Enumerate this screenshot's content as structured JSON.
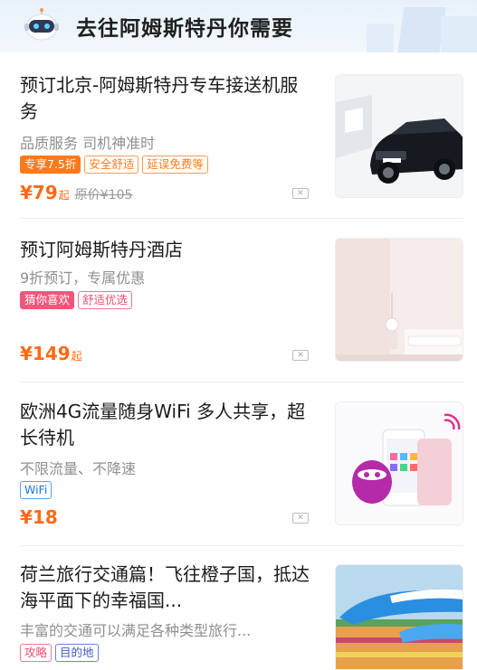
{
  "header": {
    "title": "去往阿姆斯特丹你需要",
    "icon": "robot-icon"
  },
  "cards": [
    {
      "title": "预订北京-阿姆斯特丹专车接送机服务",
      "subtitle": "品质服务 司机神准时",
      "tags": [
        "专享7.5折",
        "安全舒适",
        "延误免费等"
      ],
      "price": "¥79",
      "price_suffix": "起",
      "original_price": "原价¥105",
      "image": "black-suv-image"
    },
    {
      "title": "预订阿姆斯特丹酒店",
      "subtitle": "9折预订，专属优惠",
      "tags": [
        "猜你喜欢",
        "舒适优选"
      ],
      "price": "¥149",
      "price_suffix": "起",
      "image": "hotel-room-image"
    },
    {
      "title": "欧洲4G流量随身WiFi 多人共享，超长待机",
      "subtitle": "不限流量、不降速",
      "tags": [
        "WiFi"
      ],
      "price": "¥18",
      "image": "wifi-device-image"
    },
    {
      "title": "荷兰旅行交通篇！飞往橙子国，抵达海平面下的幸福国...",
      "subtitle": "丰富的交通可以满足各种类型旅行...",
      "tags": [
        "攻略",
        "目的地"
      ],
      "image": "klm-airplane-image"
    }
  ],
  "colors": {
    "accent_orange": "#ff6a14",
    "header_bg": "#e8f1fb"
  }
}
